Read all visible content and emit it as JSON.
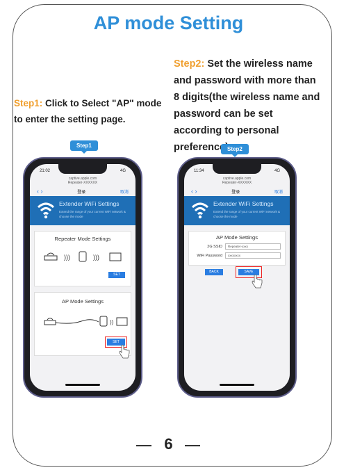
{
  "title": "AP mode Setting",
  "step1": {
    "label": "Step1:",
    "text": " Click to Select \"AP\" mode to enter the setting page.",
    "badge": "Step1",
    "phone": {
      "time": "21:02",
      "signal": "4G",
      "url_line1": "captive.apple.com",
      "url_line2": "Repeater-XXXXXX",
      "nav_title": "登录",
      "nav_cancel": "取消",
      "banner_title": "Extender WiFi Settings",
      "banner_subtitle": "Extend the range of your current WiFi network & choose the mode",
      "repeater_title": "Repeater Mode Settings",
      "repeater_button": "SET",
      "ap_title": "AP Mode Settings",
      "ap_button": "SET"
    }
  },
  "step2": {
    "label": "Step2:",
    "text": " Set the wireless name and password with more than 8 digits(the wireless name and password can be set according to personal preference).",
    "badge": "Step2",
    "phone": {
      "time": "11:34",
      "signal": "4G",
      "url_line1": "captive.apple.com",
      "url_line2": "Repeater-XXXXXX",
      "nav_title": "登录",
      "nav_cancel": "取消",
      "banner_title": "Extender WiFi Settings",
      "banner_subtitle": "Extend the range of your current WiFi network & choose the mode",
      "form_title": "AP Mode Settings",
      "ssid_label": "2G SSID",
      "ssid_value": "Repeater-xxxx",
      "password_label": "WiFi Password",
      "password_value": "xxxxxxxx",
      "back_button": "BACK",
      "save_button": "SAVE"
    }
  },
  "page_number": "6",
  "colors": {
    "accent_blue": "#2f8fd8",
    "step_orange": "#f0a030",
    "highlight_red": "#e22"
  }
}
